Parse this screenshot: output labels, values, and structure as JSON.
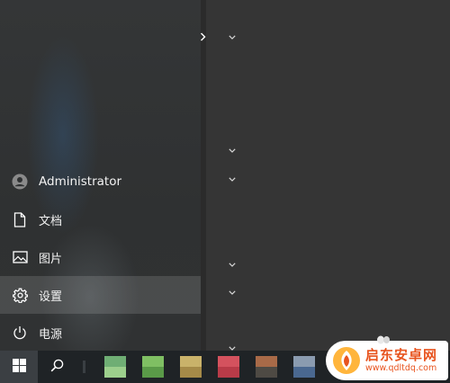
{
  "start_menu": {
    "user": {
      "name": "Administrator",
      "icon": "user-avatar-icon"
    },
    "items": [
      {
        "key": "documents",
        "label": "文档",
        "icon": "document-icon"
      },
      {
        "key": "pictures",
        "label": "图片",
        "icon": "picture-icon"
      },
      {
        "key": "settings",
        "label": "设置",
        "icon": "gear-icon",
        "active": true
      },
      {
        "key": "power",
        "label": "电源",
        "icon": "power-icon"
      }
    ],
    "expand_icon": "chevron-right-icon"
  },
  "tile_groups": {
    "collapse_icon": "chevron-down-icon",
    "count": 7
  },
  "taskbar": {
    "start_icon": "windows-logo-icon",
    "search_icon": "search-icon",
    "pinned_apps": [
      {
        "icon": "pixelated-app-icon",
        "colors": [
          "#6fae74",
          "#9ccf8c"
        ]
      },
      {
        "icon": "pixelated-app-icon",
        "colors": [
          "#7fbf63",
          "#5a9a48"
        ]
      },
      {
        "icon": "pixelated-app-icon",
        "colors": [
          "#c9b26a",
          "#a58a48"
        ]
      },
      {
        "icon": "pixelated-app-icon",
        "colors": [
          "#d4525e",
          "#b83b48"
        ]
      },
      {
        "icon": "pixelated-app-icon",
        "colors": [
          "#a86a48",
          "#4e4a44"
        ]
      },
      {
        "icon": "pixelated-app-icon",
        "colors": [
          "#8a9bb0",
          "#4a6890"
        ]
      }
    ]
  },
  "watermark": {
    "title": "启东安卓网",
    "url": "www.qdltdq.com",
    "accent": "#e8541f"
  }
}
